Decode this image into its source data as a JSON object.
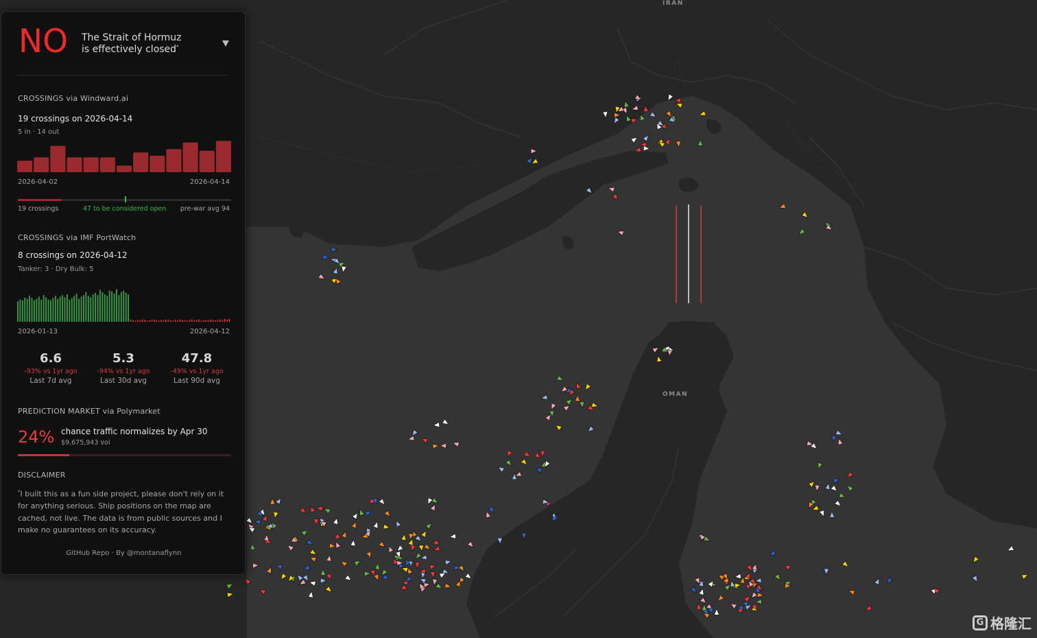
{
  "map": {
    "labels": {
      "iran": "IRAN",
      "oman": "OMAN"
    }
  },
  "header": {
    "answer": "NO",
    "line1": "The Strait of Hormuz",
    "line2": "is effectively closed",
    "footnote_mark": "*"
  },
  "windward": {
    "section_title": "CROSSINGS via Windward.ai",
    "headline": "19 crossings on 2026-04-14",
    "breakdown": "5 in · 14 out",
    "date_start": "2026-04-02",
    "date_end": "2026-04-14",
    "progress_left": "19 crossings",
    "progress_mid": "47 to be considered open",
    "progress_right": "pre-war avg 94",
    "bar_color": "#9b2a2f"
  },
  "portwatch": {
    "section_title": "CROSSINGS via IMF PortWatch",
    "headline": "8 crossings on 2026-04-12",
    "breakdown": "Tanker: 3 · Dry Bulk: 5",
    "date_start": "2026-01-13",
    "date_end": "2026-04-12",
    "stats": [
      {
        "value": "6.6",
        "delta": "-93% vs 1yr ago",
        "label": "Last 7d avg"
      },
      {
        "value": "5.3",
        "delta": "-94% vs 1yr ago",
        "label": "Last 30d avg"
      },
      {
        "value": "47.8",
        "delta": "-49% vs 1yr ago",
        "label": "Last 90d avg"
      }
    ]
  },
  "prediction": {
    "section_title": "PREDICTION MARKET via Polymarket",
    "percent": "24%",
    "text": "chance traffic normalizes by Apr 30",
    "volume": "$9,675,943 vol",
    "probability": 0.24
  },
  "disclaimer": {
    "title": "DISCLAIMER",
    "mark": "*",
    "text": "I built this as a fun side project, please don't rely on it for anything serious. Ship positions on the map are cached, not live. The data is from public sources and I make no guarantees on its accuracy."
  },
  "footer": {
    "repo": "GitHub Repo",
    "sep": " · ",
    "by": "By @montanaflynn"
  },
  "watermark": "格隆汇",
  "chart_data": [
    {
      "type": "bar",
      "source": "Windward.ai",
      "categories": [
        "2026-04-02",
        "2026-04-03",
        "2026-04-04",
        "2026-04-05",
        "2026-04-06",
        "2026-04-07",
        "2026-04-08",
        "2026-04-09",
        "2026-04-10",
        "2026-04-11",
        "2026-04-12",
        "2026-04-13",
        "2026-04-14"
      ],
      "values": [
        7,
        9,
        16,
        9,
        9,
        9,
        4,
        12,
        10,
        14,
        18,
        13,
        19
      ],
      "ylim": [
        0,
        20
      ]
    },
    {
      "type": "bar",
      "source": "IMF PortWatch",
      "range": [
        "2026-01-13",
        "2026-04-12"
      ],
      "values": [
        55,
        60,
        58,
        65,
        62,
        70,
        64,
        58,
        62,
        68,
        60,
        72,
        66,
        60,
        58,
        64,
        70,
        62,
        68,
        72,
        66,
        74,
        60,
        64,
        70,
        76,
        62,
        68,
        72,
        80,
        70,
        66,
        74,
        78,
        72,
        86,
        80,
        74,
        70,
        84,
        82,
        76,
        88,
        72,
        80,
        84,
        78,
        74,
        6,
        4,
        3,
        5,
        4,
        6,
        5,
        3,
        4,
        5,
        6,
        4,
        3,
        5,
        4,
        6,
        5,
        4,
        3,
        5,
        4,
        6,
        5,
        4,
        3,
        5,
        6,
        4,
        5,
        6,
        3,
        4,
        5,
        4,
        6,
        5,
        4,
        5,
        6,
        4,
        8,
        6,
        8
      ],
      "ylim": [
        0,
        100
      ],
      "series_colors": {
        "pre": "#3a9a4a",
        "post": "#c0353b"
      }
    }
  ]
}
